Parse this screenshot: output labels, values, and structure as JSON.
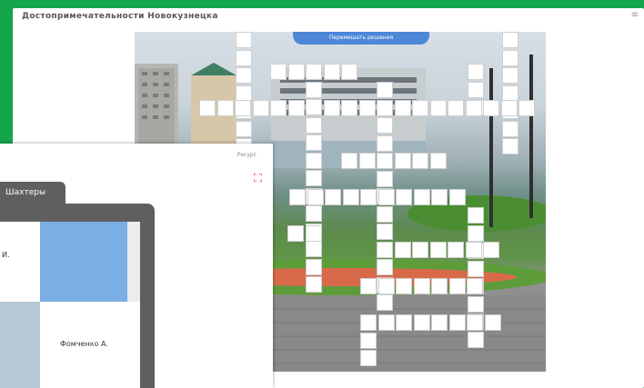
{
  "crossword_window": {
    "title": "Достопримечательности Новокузнецка",
    "close_glyph": "≡",
    "shuffle_button": "Перемешать решения"
  },
  "puzzle_window": {
    "corner_label": "Ресурс",
    "tab_label": "Шахтеры",
    "piece_label_top": "И.",
    "piece_label_bottom": "Фомченко А."
  },
  "colors": {
    "background": "#14a64a",
    "accent": "#4d87d8",
    "frame": "#5f5f5f"
  }
}
